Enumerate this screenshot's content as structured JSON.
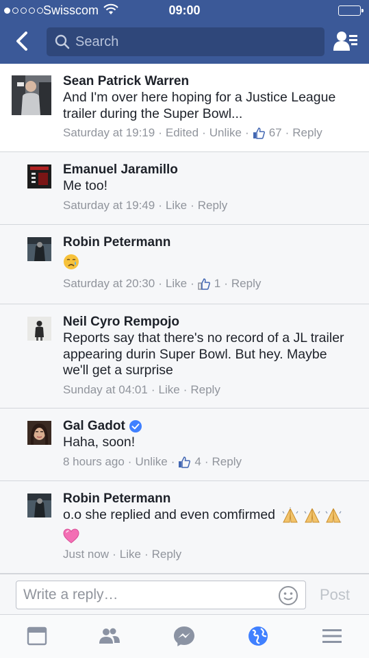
{
  "status_bar": {
    "carrier": "Swisscom",
    "time": "09:00",
    "signal_bars_filled": 1,
    "signal_bars_total": 5
  },
  "header": {
    "search_placeholder": "Search",
    "icons": [
      "back-arrow-icon",
      "search-icon",
      "friend-requests-icon"
    ]
  },
  "colors": {
    "brand": "#3b5998",
    "meta_gray": "#90949c",
    "like_blue": "#4267b2",
    "verified_blue": "#4080ff"
  },
  "comments": [
    {
      "author": "Sean Patrick Warren",
      "lines": [
        "And I'm over here hoping for a Justice League",
        "trailer during the Super Bowl..."
      ],
      "time": "Saturday at 19:19",
      "edited": "Edited",
      "action": "Unlike",
      "likes": "67",
      "reply": "Reply"
    },
    {
      "author": "Emanuel Jaramillo",
      "lines": [
        "Me too!"
      ],
      "time": "Saturday at 19:49",
      "action": "Like",
      "reply": "Reply"
    },
    {
      "author": "Robin Petermann",
      "emoji": "crying-face",
      "time": "Saturday at 20:30",
      "action": "Like",
      "likes": "1",
      "reply": "Reply"
    },
    {
      "author": "Neil Cyro Rempojo",
      "lines": [
        "Reports say that there's no record of a JL trailer",
        "appearing durin Super Bowl. But hey. Maybe",
        "we'll get a surprise"
      ],
      "time": "Sunday at 04:01",
      "action": "Like",
      "reply": "Reply"
    },
    {
      "author": "Gal Gadot",
      "verified": true,
      "lines": [
        "Haha, soon!"
      ],
      "time": "8 hours ago",
      "action": "Unlike",
      "likes": "4",
      "reply": "Reply"
    },
    {
      "author": "Robin Petermann",
      "lines": [
        "o.o she replied and even comfirmed"
      ],
      "emojis": [
        "folded-hands",
        "folded-hands",
        "folded-hands",
        "pink-heart"
      ],
      "time": "Just now",
      "action": "Like",
      "reply": "Reply"
    }
  ],
  "composer": {
    "placeholder": "Write a reply…",
    "post_label": "Post"
  },
  "tabbar": [
    "news-feed-icon",
    "friends-icon",
    "messenger-icon",
    "notifications-globe-icon",
    "menu-icon"
  ]
}
